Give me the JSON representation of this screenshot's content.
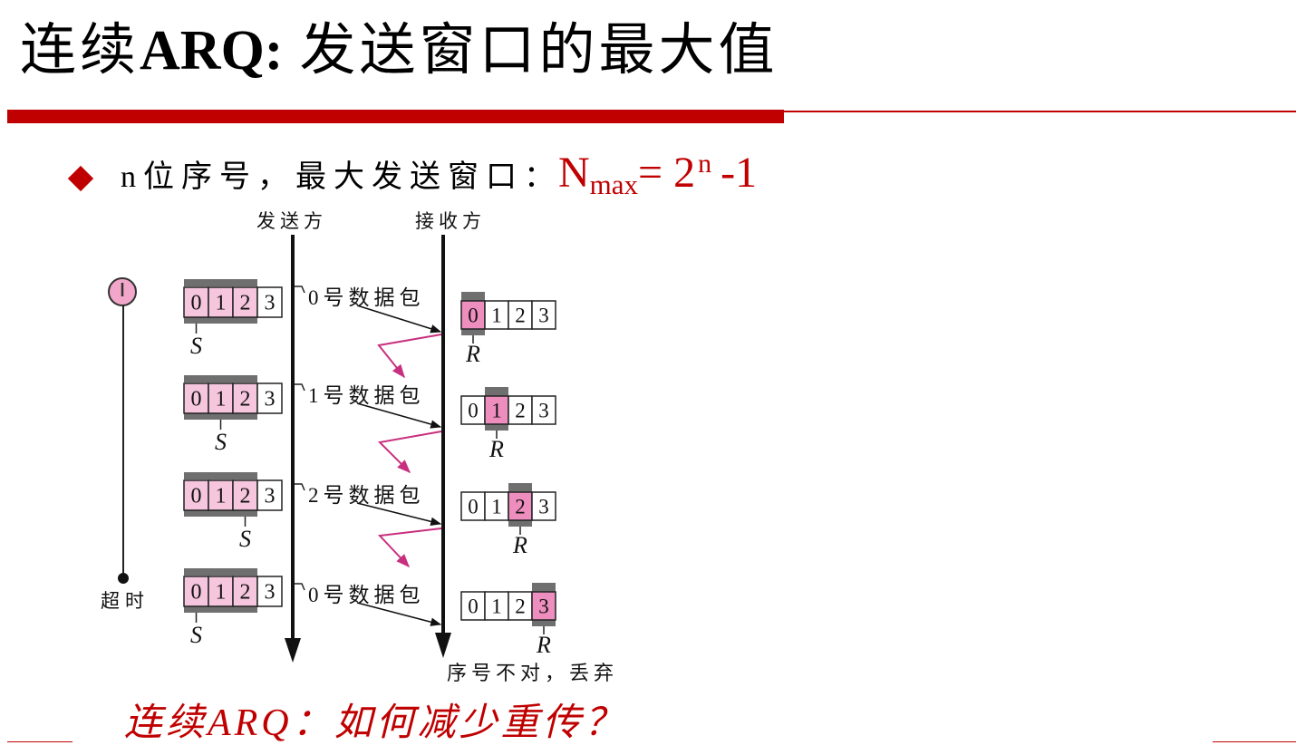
{
  "slide": {
    "title": {
      "prefix": "连续",
      "bold": "ARQ:",
      "rest": "发送窗口的最大值"
    },
    "bullet": {
      "text": "n位序号，最大发送窗口：",
      "formula": {
        "base": "N",
        "sub": "max",
        "eq": "= 2",
        "sup": "n",
        "tail": "-1"
      }
    },
    "footer_question": "连续ARQ：如何减少重传？"
  },
  "diagram": {
    "sender_label": "发送方",
    "receiver_label": "接收方",
    "timeout_label": "超时",
    "discard_label": "序号不对，丢弃",
    "sequence_numbers": [
      "0",
      "1",
      "2",
      "3"
    ],
    "sender_pointer": "S",
    "receiver_pointer": "R",
    "packets": [
      "0号数据包",
      "1号数据包",
      "2号数据包",
      "0号数据包"
    ],
    "sender_window_size": 3,
    "sender_pointer_at": [
      0,
      1,
      2,
      0
    ],
    "receiver_pointer_at": [
      0,
      1,
      2,
      3
    ]
  },
  "icons": {
    "bullet": "diamond-icon",
    "timer": "timer-icon"
  },
  "colors": {
    "accent_red": "#c00000",
    "sender_window_pink": "#f5c6de",
    "receiver_window_pink": "#ee8ebf",
    "window_bar_gray": "#6f6f6f",
    "ack_magenta": "#c8307f",
    "timer_pink": "#f2a7ca"
  }
}
